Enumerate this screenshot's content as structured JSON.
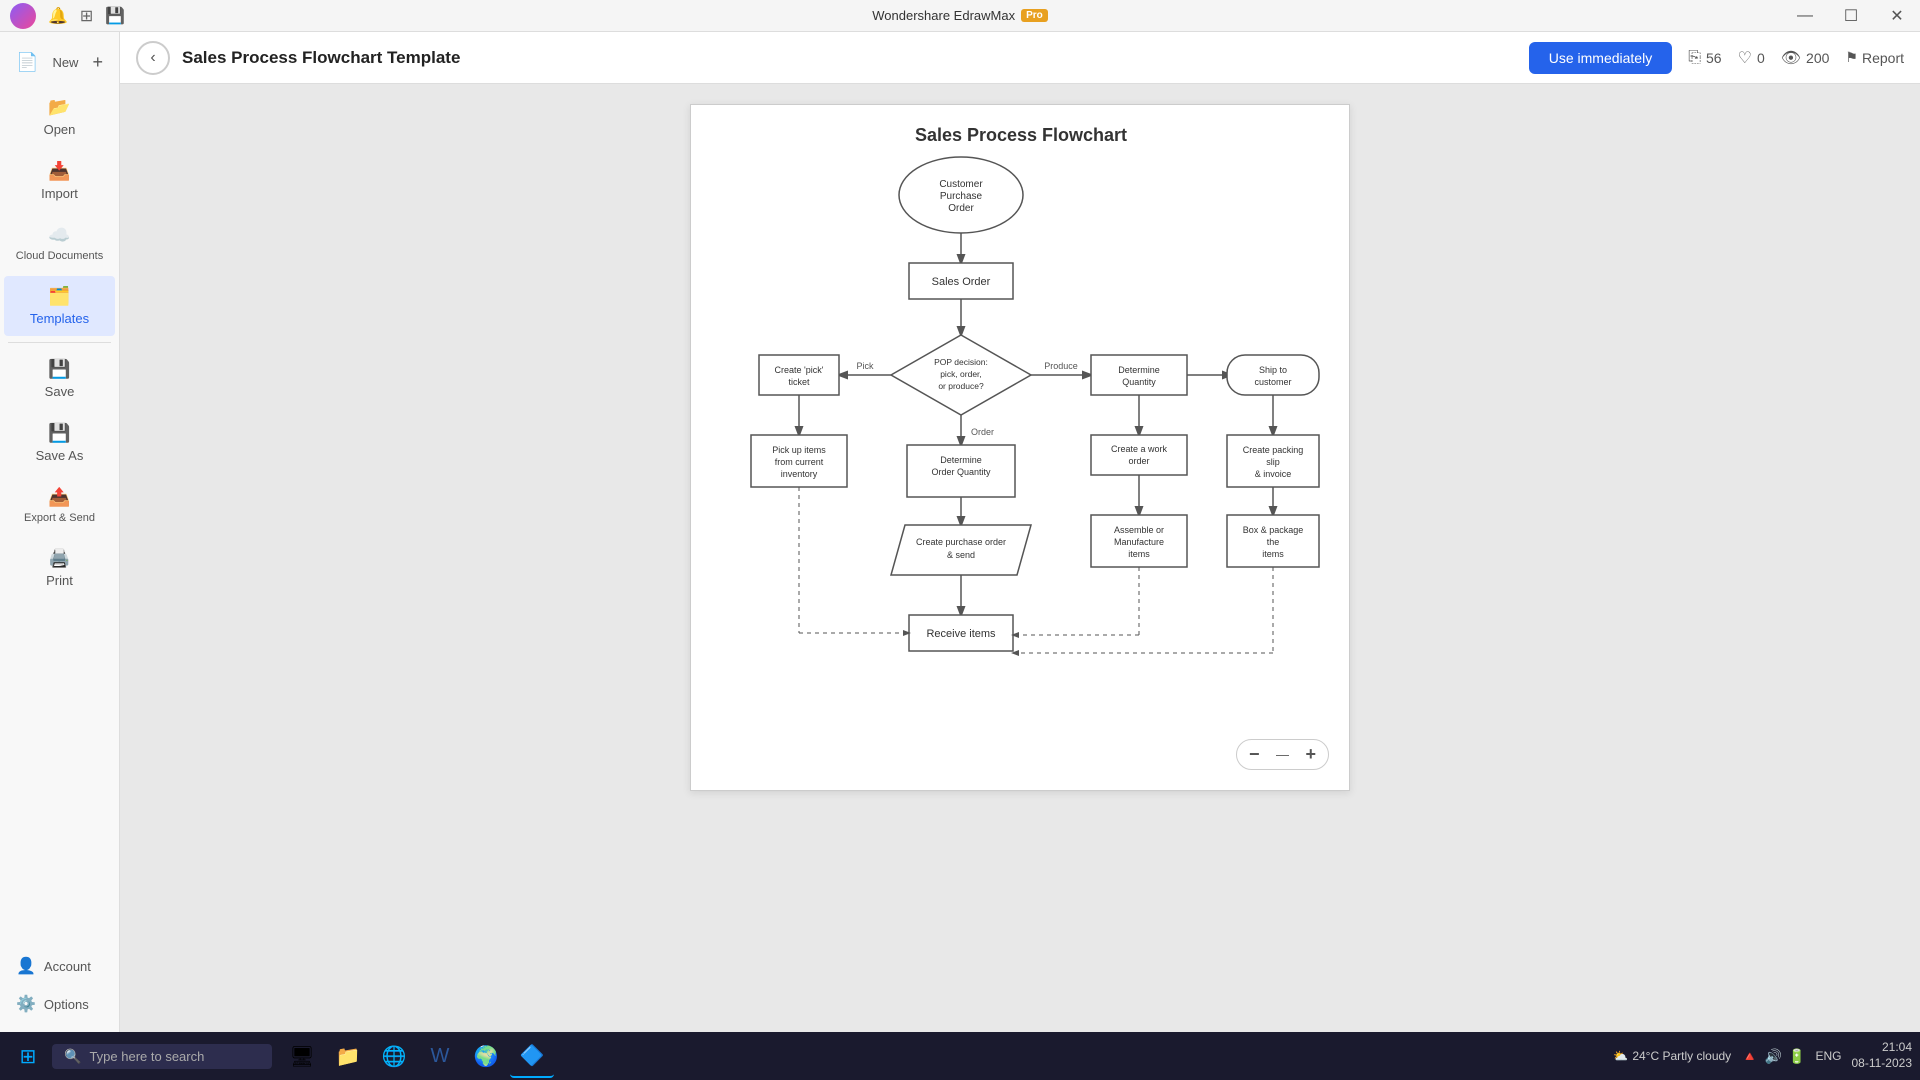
{
  "app": {
    "title": "Wondershare EdrawMax",
    "pro_label": "Pro"
  },
  "titlebar": {
    "minimize": "—",
    "maximize": "☐",
    "close": "✕"
  },
  "sidebar": {
    "items": [
      {
        "id": "new",
        "label": "New",
        "icon": "📄"
      },
      {
        "id": "open",
        "label": "Open",
        "icon": "📂"
      },
      {
        "id": "import",
        "label": "Import",
        "icon": "📥"
      },
      {
        "id": "cloud",
        "label": "Cloud Documents",
        "icon": "☁️"
      },
      {
        "id": "templates",
        "label": "Templates",
        "icon": "🗂️"
      },
      {
        "id": "save",
        "label": "Save",
        "icon": "💾"
      },
      {
        "id": "saveas",
        "label": "Save As",
        "icon": "💾"
      },
      {
        "id": "export",
        "label": "Export & Send",
        "icon": "📤"
      },
      {
        "id": "print",
        "label": "Print",
        "icon": "🖨️"
      }
    ],
    "bottom_items": [
      {
        "id": "account",
        "label": "Account",
        "icon": "👤"
      },
      {
        "id": "options",
        "label": "Options",
        "icon": "⚙️"
      }
    ]
  },
  "header": {
    "back_label": "‹",
    "title": "Sales Process Flowchart Template",
    "use_immediately": "Use immediately",
    "stats": {
      "copies": "56",
      "likes": "0",
      "views": "200"
    },
    "report_label": "Report"
  },
  "diagram": {
    "title": "Sales Process Flowchart",
    "nodes": {
      "customer_purchase": "Customer Purchase Order",
      "sales_order": "Sales Order",
      "pop_decision": "POP decision: pick, order, or produce?",
      "create_pick": "Create 'pick' ticket",
      "pick_up_items": "Pick up items from current inventory",
      "determine_order_qty": "Determine Order Quantity",
      "create_purchase": "Create purchase order & send",
      "receive_items": "Receive items",
      "determine_quantity": "Determine Quantity",
      "create_work_order": "Create a work order",
      "assemble": "Assemble or Manufacture items",
      "box_package": "Box & package the items",
      "create_packing": "Create packing slip & invoice",
      "ship_customer": "Ship to customer"
    },
    "labels": {
      "pick": "Pick",
      "produce": "Produce",
      "order": "Order"
    }
  },
  "zoom": {
    "minus": "−",
    "level": "—",
    "plus": "+"
  },
  "taskbar": {
    "search_placeholder": "Type here to search",
    "apps": [
      "⊞",
      "🔍",
      "🖥",
      "📁",
      "🌐",
      "📝",
      "🌍",
      "🔷"
    ],
    "weather": "24°C Partly cloudy",
    "time": "21:04",
    "date": "08-11-2023",
    "language": "ENG"
  }
}
